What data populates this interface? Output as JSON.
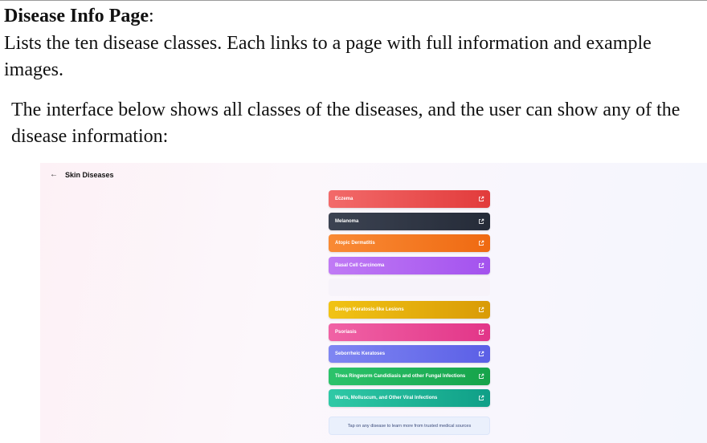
{
  "doc": {
    "heading": "Disease Info Page",
    "heading_suffix": ":",
    "paragraph1": "Lists the ten disease classes. Each links to a page with full information and example images.",
    "paragraph2": "The interface below shows all classes of the diseases, and the user can show any of the disease information:"
  },
  "app": {
    "title": "Skin Diseases",
    "back_icon": "arrow-left-icon",
    "items": [
      {
        "label": "Eczema",
        "color_start": "#f26a6a",
        "color_end": "#e23b3b",
        "icon": "external-link-icon"
      },
      {
        "label": "Melanoma",
        "color_start": "#3c4352",
        "color_end": "#252b38",
        "icon": "external-link-icon"
      },
      {
        "label": "Atopic Dermatitis",
        "color_start": "#f98a35",
        "color_end": "#ef6a12",
        "icon": "external-link-icon"
      },
      {
        "label": "Basal Cell Carcinoma",
        "color_start": "#c07af5",
        "color_end": "#a352ee",
        "icon": "external-link-icon"
      },
      {
        "label": "",
        "color_start": "#f7f3fa",
        "color_end": "#f7f3fa",
        "icon": ""
      },
      {
        "label": "Benign Keratosis-like Lesions",
        "color_start": "#f1c315",
        "color_end": "#d99b06",
        "icon": "external-link-icon"
      },
      {
        "label": "Psoriasis",
        "color_start": "#f062a5",
        "color_end": "#e23588",
        "icon": "external-link-icon"
      },
      {
        "label": "Seborrheic Keratoses",
        "color_start": "#7f86f2",
        "color_end": "#5b5fe6",
        "icon": "external-link-icon"
      },
      {
        "label": "Tinea Ringworm Candidiasis and other Fungal Infections",
        "color_start": "#2cc36b",
        "color_end": "#16a34a",
        "icon": "external-link-icon"
      },
      {
        "label": "Warts, Molluscum, and Other Viral Infections",
        "color_start": "#2fc9a6",
        "color_end": "#0f9f87",
        "icon": "external-link-icon"
      }
    ],
    "footer_note": "Tap on any disease to learn more from trusted medical sources"
  }
}
